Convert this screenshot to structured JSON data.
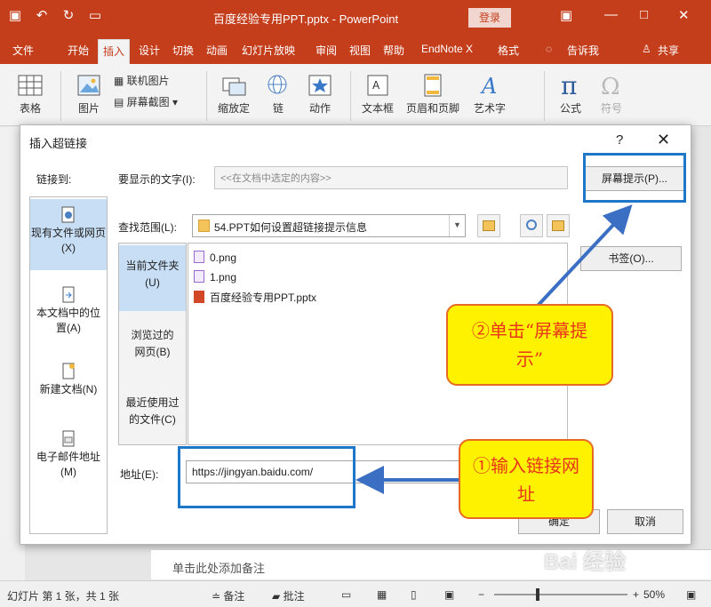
{
  "app": {
    "title": "百度经验专用PPT.pptx - PowerPoint",
    "login_label": "登录"
  },
  "menu": {
    "tabs": [
      "文件",
      "开始",
      "插入",
      "设计",
      "切换",
      "动画",
      "幻灯片放映",
      "审阅",
      "视图",
      "帮助",
      "EndNote X",
      "格式"
    ],
    "active_tab": "插入",
    "tell_me": "告诉我",
    "share": "共享"
  },
  "ribbon": {
    "table": "表格",
    "picture": "图片",
    "online_picture": "联机图片",
    "screenshot": "屏幕截图",
    "zoom": "缩放定",
    "link": "链",
    "action": "动作",
    "textbox": "文本框",
    "header_footer": "页眉和页脚",
    "wordart": "艺术字",
    "equation": "公式",
    "symbol": "符号"
  },
  "dialog": {
    "title": "插入超链接",
    "help": "?",
    "link_to_label": "链接到:",
    "link_to_items": [
      {
        "label": "现有文件或网页(X)",
        "selected": true
      },
      {
        "label": "本文档中的位置(A)",
        "selected": false
      },
      {
        "label": "新建文档(N)",
        "selected": false
      },
      {
        "label": "电子邮件地址(M)",
        "selected": false
      }
    ],
    "display_text_label": "要显示的文字(I):",
    "display_text_value": "<<在文档中选定的内容>>",
    "screen_tip_button": "屏幕提示(P)...",
    "look_in_label": "查找范围(L):",
    "look_in_value": "54.PPT如何设置超链接提示信息",
    "bookmark_button": "书签(O)...",
    "look_in_items": [
      {
        "label": "当前文件夹(U)",
        "selected": true
      },
      {
        "label": "浏览过的网页(B)",
        "selected": false
      },
      {
        "label": "最近使用过的文件(C)",
        "selected": false
      }
    ],
    "files": [
      {
        "name": "0.png",
        "type": "png"
      },
      {
        "name": "1.png",
        "type": "png"
      },
      {
        "name": "百度经验专用PPT.pptx",
        "type": "pptx"
      }
    ],
    "address_label": "地址(E):",
    "address_value": "https://jingyan.baidu.com/",
    "ok_button": "确定",
    "cancel_button": "取消"
  },
  "annotations": {
    "step2": "②单击“屏幕提示”",
    "step1": "①输入链接网址",
    "colors": {
      "box": "#1e76c8",
      "callout_fill": "#fef200",
      "callout_text": "#e8361c"
    }
  },
  "notes_placeholder": "单击此处添加备注",
  "status": {
    "slide_info": "幻灯片 第 1 张，共 1 张",
    "notes": "备注",
    "comments": "批注",
    "zoom": "50%"
  },
  "watermark": "Bai 经验"
}
